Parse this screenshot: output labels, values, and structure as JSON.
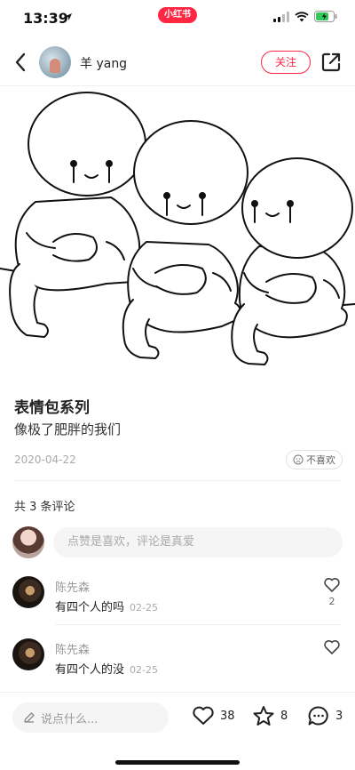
{
  "status_bar": {
    "time": "13:39",
    "app_label": "小红书"
  },
  "header": {
    "username": "羊 yang",
    "follow_label": "关注"
  },
  "post": {
    "title": "表情包系列",
    "description": "像极了肥胖的我们",
    "date": "2020-04-22",
    "dislike_label": "不喜欢"
  },
  "comments_section": {
    "count_label": "共 3 条评论",
    "input_placeholder": "点赞是喜欢，评论是真爱",
    "items": [
      {
        "name": "陈先森",
        "text": "有四个人的吗",
        "time": "02-25",
        "likes": "2"
      },
      {
        "name": "陈先森",
        "text": "有四个人的没",
        "time": "02-25",
        "likes": ""
      }
    ]
  },
  "bottom_bar": {
    "input_placeholder": "说点什么...",
    "likes": "38",
    "collects": "8",
    "comments": "3"
  },
  "colors": {
    "brand": "#ff2742",
    "muted": "#999999"
  }
}
